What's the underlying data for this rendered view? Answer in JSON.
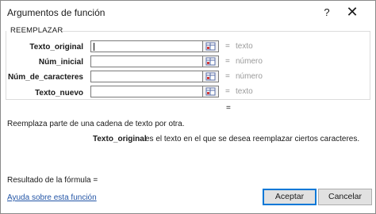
{
  "window": {
    "title": "Argumentos de función",
    "help_glyph": "?",
    "close_glyph": "✕"
  },
  "function_group": {
    "name": "REEMPLAZAR",
    "arguments": [
      {
        "label": "Texto_original",
        "value": "",
        "eq": "=",
        "hint": "texto"
      },
      {
        "label": "Núm_inicial",
        "value": "",
        "eq": "=",
        "hint": "número"
      },
      {
        "label": "Núm_de_caracteres",
        "value": "",
        "eq": "=",
        "hint": "número"
      },
      {
        "label": "Texto_nuevo",
        "value": "",
        "eq": "=",
        "hint": "texto"
      }
    ]
  },
  "result_eq": "=",
  "description": "Reemplaza parte de una cadena de texto por otra.",
  "argument_description": {
    "name": "Texto_original",
    "text": "es el texto en el que se desea reemplazar ciertos caracteres."
  },
  "formula_result_label": "Resultado de la fórmula =",
  "help_link": "Ayuda sobre esta función",
  "buttons": {
    "accept": "Aceptar",
    "cancel": "Cancelar"
  },
  "icons": {
    "range_selector": "collapse-range-icon"
  }
}
